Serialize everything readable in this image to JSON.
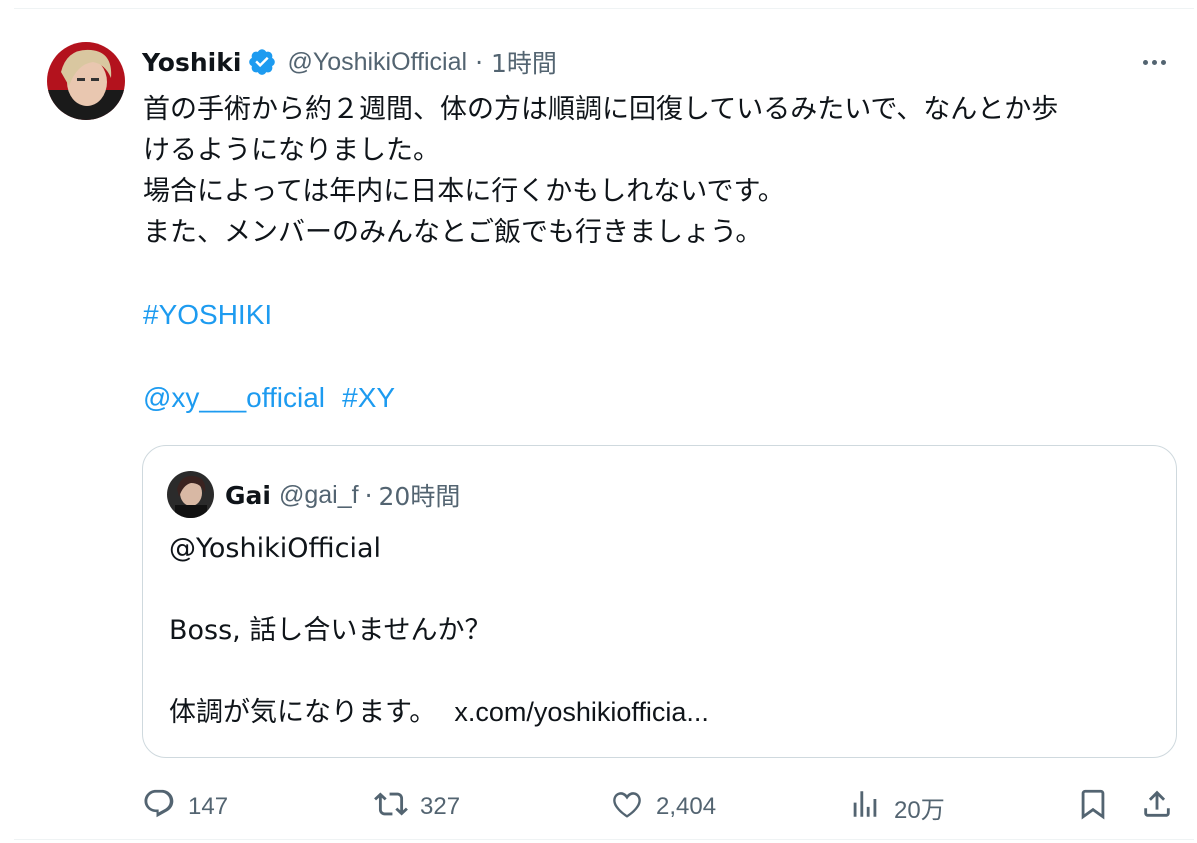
{
  "tweet": {
    "author_name": "Yoshiki",
    "author_handle": "@YoshikiOfficial",
    "separator": "·",
    "time": "1時間",
    "lines": [
      "首の手術から約２週間、体の方は順調に回復しているみたいで、なんとか歩",
      "けるようになりました。",
      "場合によっては年内に日本に行くかもしれないです。",
      "また、メンバーのみんなとご飯でも行きましょう。"
    ],
    "hashtag1": "#YOSHIKI",
    "mention": "@xy___official",
    "hashtag2": "#XY"
  },
  "quote": {
    "author_name": "Gai",
    "author_handle": "@gai_f",
    "separator": "·",
    "time": "20時間",
    "line1": "@YoshikiOfficial",
    "line2": "Boss, 話し合いませんか？",
    "line3": "体調が気になります。",
    "link": "x.com/yoshikiofficia..."
  },
  "actions": {
    "replies": "147",
    "retweets": "327",
    "likes": "2,404",
    "views": "20万"
  },
  "colors": {
    "accent": "#1d9bf0",
    "text": "#0f1419",
    "muted": "#536471",
    "border": "#cfd9de"
  },
  "icons": [
    "verified-badge-icon",
    "more-icon",
    "reply-icon",
    "retweet-icon",
    "like-icon",
    "views-icon",
    "bookmark-icon",
    "share-icon"
  ]
}
